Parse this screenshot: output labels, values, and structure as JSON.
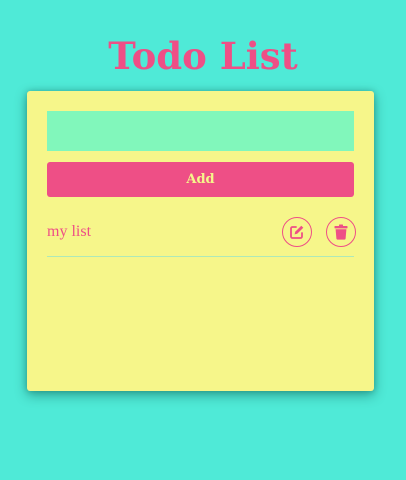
{
  "header": {
    "title": "Todo List"
  },
  "form": {
    "input_value": "",
    "input_placeholder": "",
    "add_label": "Add"
  },
  "todos": [
    {
      "text": "my list",
      "edit_icon": "edit-icon",
      "delete_icon": "trash-icon"
    }
  ],
  "colors": {
    "background": "#4fead7",
    "card": "#f6f68a",
    "accent": "#ee4f86",
    "input": "#81f7bb"
  }
}
